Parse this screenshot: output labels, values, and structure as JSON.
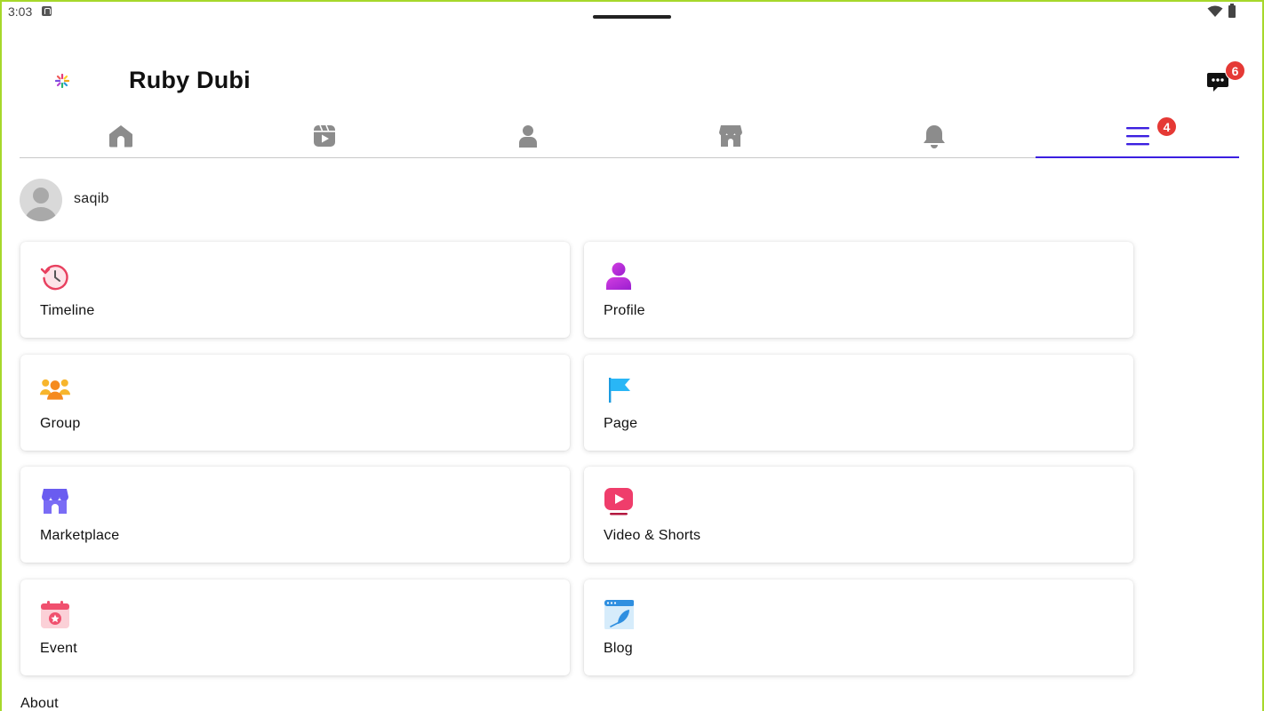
{
  "status": {
    "time": "3:03"
  },
  "header": {
    "title": "Ruby Dubi",
    "messages_badge": "6"
  },
  "tabs": [
    {
      "icon": "home-icon"
    },
    {
      "icon": "video-icon"
    },
    {
      "icon": "person-icon"
    },
    {
      "icon": "store-icon"
    },
    {
      "icon": "bell-icon"
    },
    {
      "icon": "menu-icon",
      "active": true,
      "badge": "4"
    }
  ],
  "user": {
    "name": "saqib"
  },
  "menu_items": [
    {
      "label": "Timeline",
      "icon": "timeline-icon"
    },
    {
      "label": "Profile",
      "icon": "profile-icon"
    },
    {
      "label": "Group",
      "icon": "group-icon"
    },
    {
      "label": "Page",
      "icon": "flag-icon"
    },
    {
      "label": "Marketplace",
      "icon": "marketplace-icon"
    },
    {
      "label": "Video & Shorts",
      "icon": "video-play-icon"
    },
    {
      "label": "Event",
      "icon": "calendar-icon"
    },
    {
      "label": "Blog",
      "icon": "blog-icon"
    }
  ],
  "footer": {
    "about": "About"
  },
  "colors": {
    "accent": "#3b1fe0",
    "badge": "#e53935",
    "tab_icon": "#8c8c8c"
  }
}
